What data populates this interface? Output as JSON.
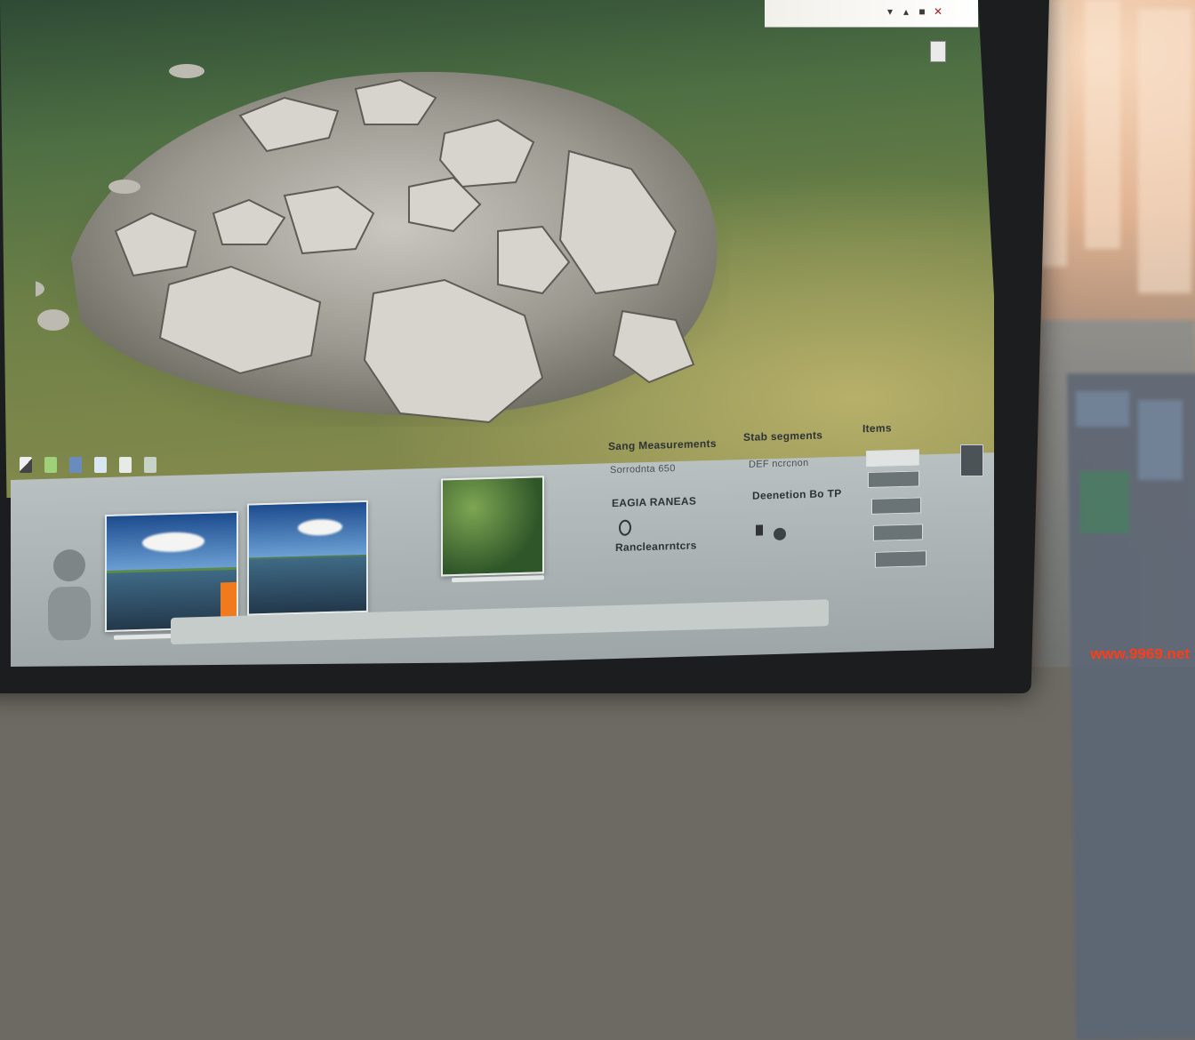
{
  "titlebar": {
    "buttons": [
      "▾",
      "▴",
      "■",
      "✕"
    ]
  },
  "panel": {
    "section_headers": [
      "Sang Measurements",
      "Stab segments",
      "Items"
    ],
    "col1_rows": [
      "Sorrodnta 650",
      "EAGIA RANEAS",
      "Rancleanrntcrs"
    ],
    "col2_rows": [
      "DEF ncrcnon",
      "Deenetion Bo TP"
    ],
    "col3_fields": [
      "",
      "",
      "",
      ""
    ]
  },
  "watermark": "www.9969.net",
  "colors": {
    "viewport_grass": "#6f8147",
    "panel": "#b9c0c1",
    "watermark": "#ff3c1a"
  }
}
